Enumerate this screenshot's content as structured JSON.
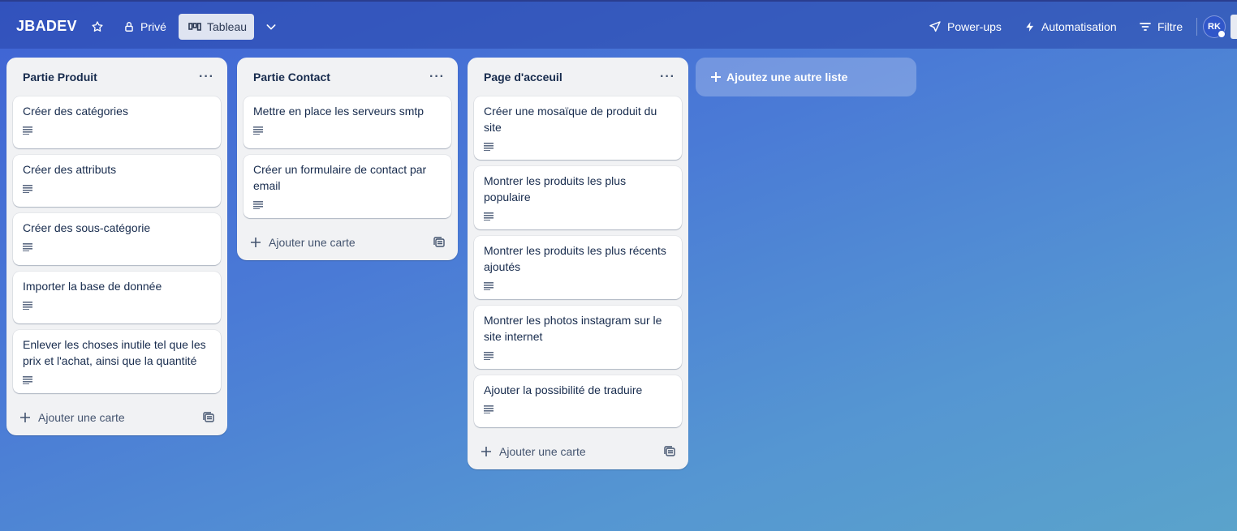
{
  "header": {
    "board_title": "JBADEV",
    "visibility_label": "Privé",
    "view_label": "Tableau",
    "powerups_label": "Power-ups",
    "automation_label": "Automatisation",
    "filter_label": "Filtre",
    "avatar_initials": "RK"
  },
  "lists": [
    {
      "title": "Partie Produit",
      "menu": "···",
      "cards": [
        {
          "text": "Créer des catégories"
        },
        {
          "text": "Créer des attributs"
        },
        {
          "text": "Créer des sous-catégorie"
        },
        {
          "text": "Importer la base de donnée"
        },
        {
          "text": "Enlever les choses inutile tel que les prix et l'achat, ainsi que la quantité"
        }
      ],
      "add_card_label": "Ajouter une carte"
    },
    {
      "title": "Partie Contact",
      "menu": "···",
      "cards": [
        {
          "text": "Mettre en place les serveurs smtp"
        },
        {
          "text": "Créer un formulaire de contact par email"
        }
      ],
      "add_card_label": "Ajouter une carte"
    },
    {
      "title": "Page d'acceuil",
      "menu": "···",
      "cards": [
        {
          "text": "Créer une mosaïque de produit du site"
        },
        {
          "text": "Montrer les produits les plus populaire"
        },
        {
          "text": "Montrer les produits les plus récents ajoutés"
        },
        {
          "text": "Montrer les photos instagram sur le site internet"
        },
        {
          "text": "Ajouter la possibilité de traduire"
        }
      ],
      "add_card_label": "Ajouter une carte"
    }
  ],
  "add_list_label": "Ajoutez une autre liste",
  "colors": {
    "list_bg": "#f1f2f4",
    "card_bg": "#ffffff",
    "text": "#172b4d",
    "header_bg": "#2846aa"
  }
}
